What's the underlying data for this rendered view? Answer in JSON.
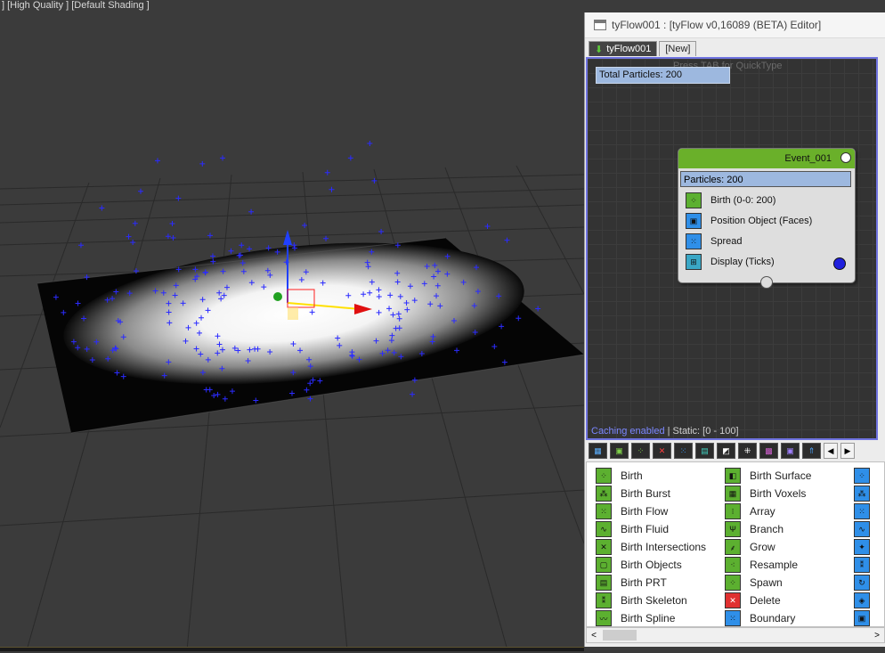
{
  "viewport": {
    "label": "] [High Quality ] [Default Shading ]"
  },
  "editor": {
    "title": "tyFlow001 : [tyFlow v0,16089 (BETA) Editor]",
    "tabs": [
      {
        "label": "tyFlow001"
      },
      {
        "label": "[New]"
      }
    ],
    "quicktype_hint": "Press TAB for QuickType",
    "total_particles": "Total Particles: 200",
    "event": {
      "name": "Event_001",
      "particles": "Particles: 200",
      "operators": [
        {
          "label": "Birth (0-0: 200)",
          "icon": "birth-icon",
          "color": "#5cb030"
        },
        {
          "label": "Position Object (Faces)",
          "icon": "position-object-icon",
          "color": "#2f8fe8"
        },
        {
          "label": "Spread",
          "icon": "spread-icon",
          "color": "#2f8fe8"
        },
        {
          "label": "Display (Ticks)",
          "icon": "display-icon",
          "color": "#3aa7c6"
        }
      ]
    },
    "status": {
      "caching": "Caching enabled",
      "rest": " | Static: [0 - 100]"
    },
    "category_icons": [
      "all-icon",
      "birth-category-icon",
      "birth-flow-category-icon",
      "delete-category-icon",
      "position-category-icon",
      "data-category-icon",
      "render-category-icon",
      "physics-category-icon",
      "mesh-category-icon",
      "misc-category-icon",
      "arrow-category-icon"
    ],
    "operators_col1": [
      {
        "label": "Birth",
        "color": "#5cb030"
      },
      {
        "label": "Birth Burst",
        "color": "#5cb030"
      },
      {
        "label": "Birth Flow",
        "color": "#5cb030"
      },
      {
        "label": "Birth Fluid",
        "color": "#5cb030"
      },
      {
        "label": "Birth Intersections",
        "color": "#5cb030"
      },
      {
        "label": "Birth Objects",
        "color": "#5cb030"
      },
      {
        "label": "Birth PRT",
        "color": "#5cb030"
      },
      {
        "label": "Birth Skeleton",
        "color": "#5cb030"
      },
      {
        "label": "Birth Spline",
        "color": "#5cb030"
      }
    ],
    "operators_col2": [
      {
        "label": "Birth Surface",
        "color": "#5cb030"
      },
      {
        "label": "Birth Voxels",
        "color": "#5cb030"
      },
      {
        "label": "Array",
        "color": "#5cb030"
      },
      {
        "label": "Branch",
        "color": "#5cb030"
      },
      {
        "label": "Grow",
        "color": "#5cb030"
      },
      {
        "label": "Resample",
        "color": "#5cb030"
      },
      {
        "label": "Spawn",
        "color": "#5cb030"
      },
      {
        "label": "Delete",
        "color": "#e03030"
      },
      {
        "label": "Boundary",
        "color": "#2f8fe8"
      }
    ],
    "operators_col3_color": "#2f8fe8"
  }
}
